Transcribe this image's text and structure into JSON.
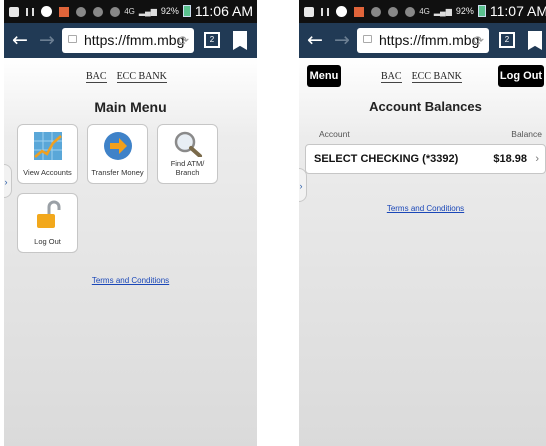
{
  "status_bar": {
    "battery_left": "92%",
    "battery_right": "92%",
    "time_left": "11:06 AM",
    "time_right": "11:07 AM",
    "signal_label": "4G"
  },
  "browser": {
    "url": "https://fmm.mbg",
    "tab_count": "2"
  },
  "brand": {
    "logo_left": "BAC",
    "logo_right": "ECC BANK"
  },
  "screen_menu": {
    "title": "Main Menu",
    "tiles": [
      {
        "label": "View Accounts",
        "icon": "chart-icon"
      },
      {
        "label": "Transfer Money",
        "icon": "transfer-arrow-icon"
      },
      {
        "label": "Find ATM/ Branch",
        "icon": "magnifier-icon"
      },
      {
        "label": "Log Out",
        "icon": "padlock-icon"
      }
    ],
    "terms": "Terms and Conditions"
  },
  "screen_balances": {
    "menu_button": "Menu",
    "logout_button": "Log Out",
    "title": "Account Balances",
    "col_account": "Account",
    "col_balance": "Balance",
    "accounts": [
      {
        "name": "SELECT CHECKING (*3392)",
        "balance": "$18.98"
      }
    ],
    "terms": "Terms and Conditions"
  },
  "colors": {
    "browser_bar": "#213a55",
    "link": "#1a47b8"
  }
}
